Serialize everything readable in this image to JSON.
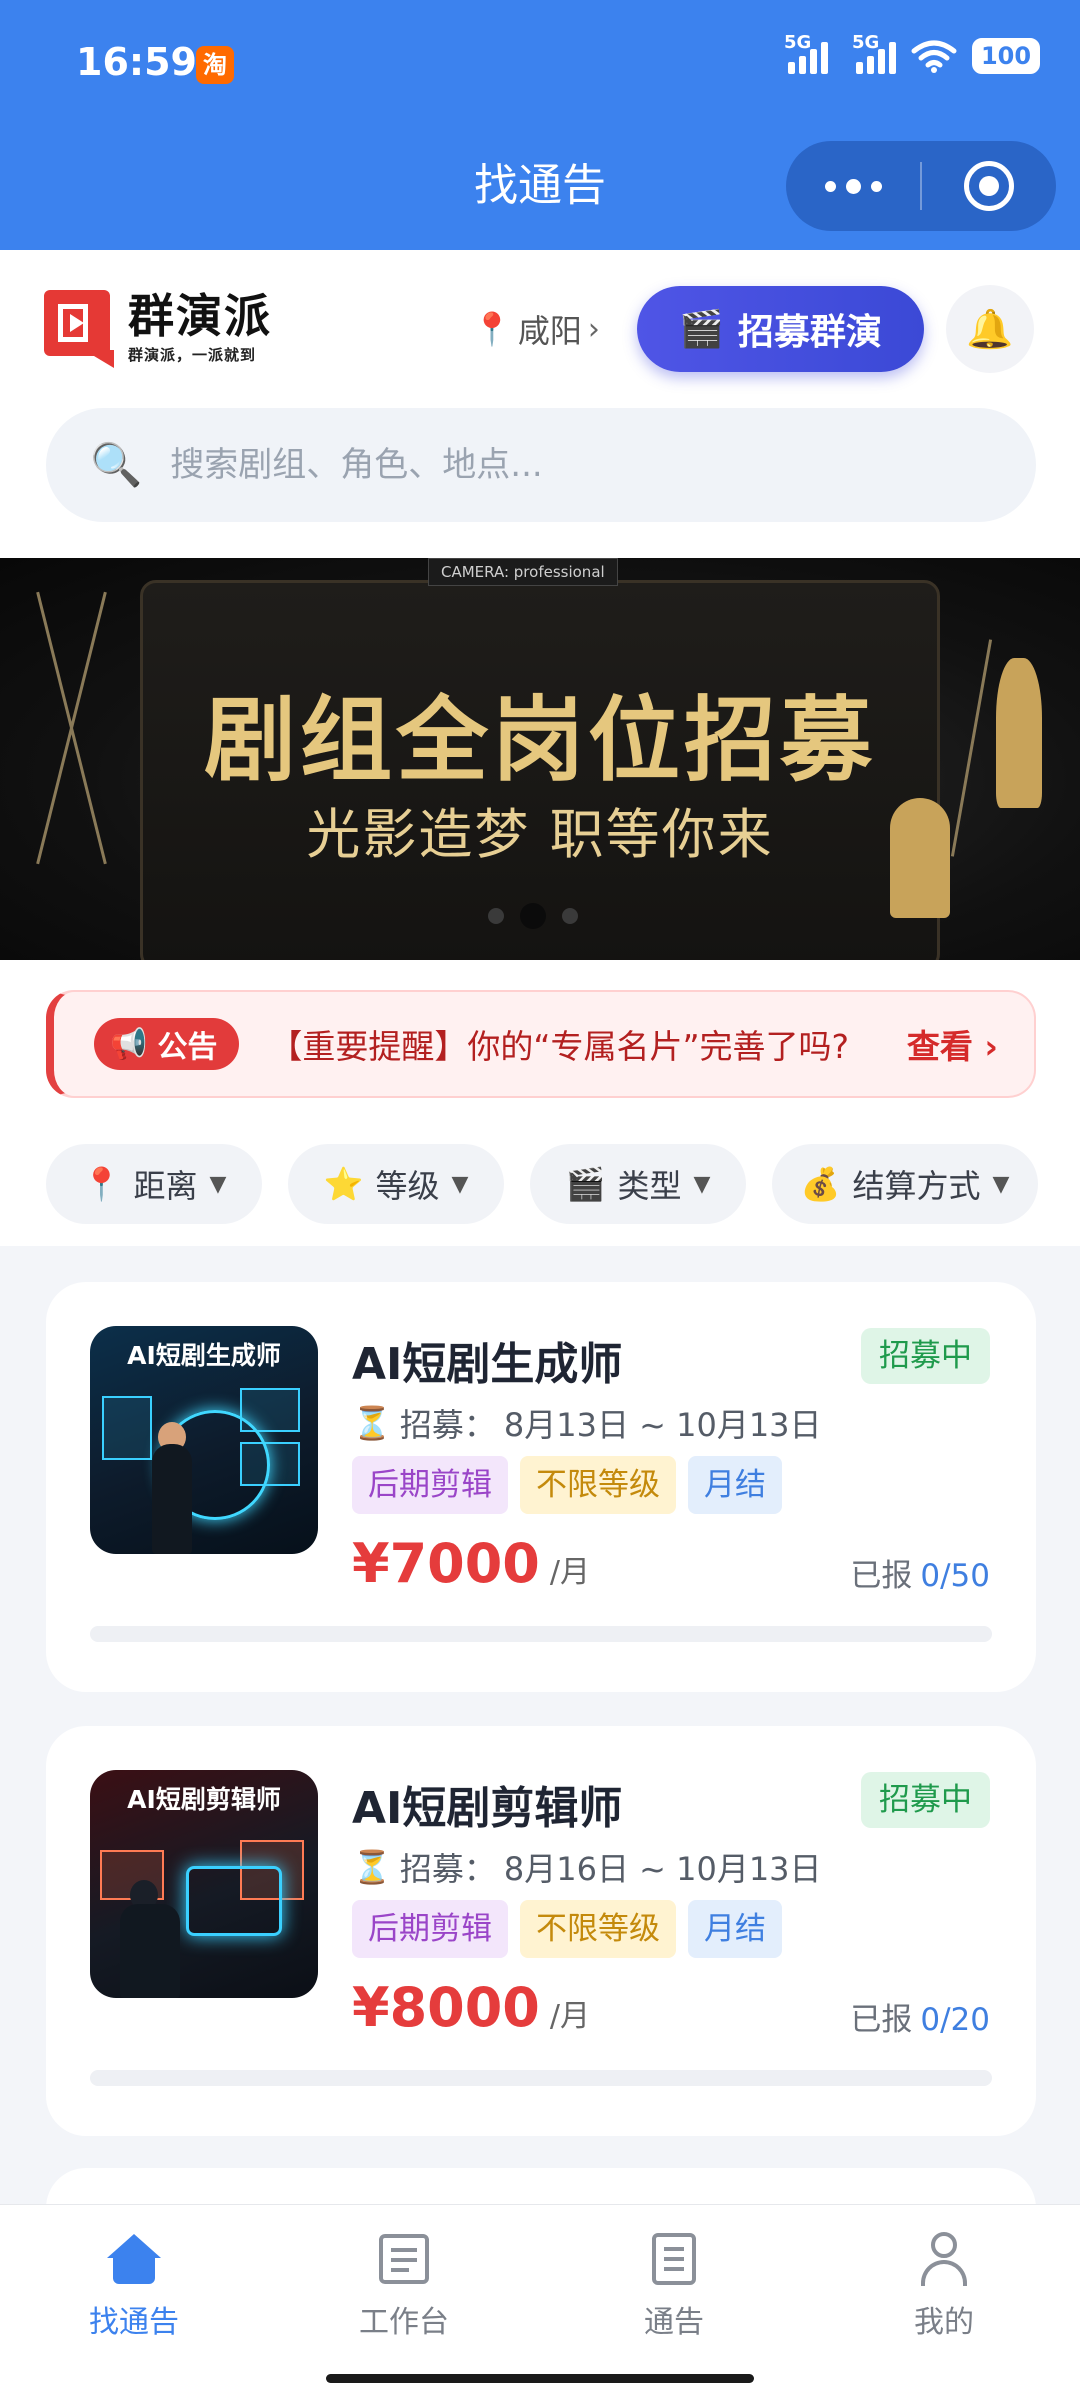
{
  "status_bar": {
    "time": "16:59",
    "app_badge": "淘",
    "network_1": "5G",
    "network_2": "5G",
    "battery": "100"
  },
  "nav": {
    "title": "找通告"
  },
  "header": {
    "brand_name": "群演派",
    "brand_slogan": "群演派，一派就到",
    "location": "咸阳",
    "recruit_button": "招募群演",
    "search_placeholder": "搜索剧组、角色、地点..."
  },
  "banner": {
    "camera_label": "CAMERA: professional",
    "title": "剧组全岗位招募",
    "subtitle": "光影造梦 职等你来",
    "slide_count": 3,
    "active_slide": 2
  },
  "notice": {
    "tag": "公告",
    "text": "【重要提醒】你的“专属名片”完善了吗?",
    "link": "查看 ›"
  },
  "filters": [
    {
      "icon": "📍",
      "label": "距离"
    },
    {
      "icon": "⭐",
      "label": "等级"
    },
    {
      "icon": "🎬",
      "label": "类型"
    },
    {
      "icon": "💰",
      "label": "结算方式"
    }
  ],
  "jobs": [
    {
      "thumb_caption": "AI短剧生成师",
      "title": "AI短剧生成师",
      "status": "招募中",
      "period_label": "招募：",
      "period": "8月13日 ~ 10月13日",
      "tags": [
        "后期剪辑",
        "不限等级",
        "月结"
      ],
      "price": "¥7000",
      "unit": "/月",
      "applied_label": "已报",
      "applied_count": "0/50",
      "progress": 0
    },
    {
      "thumb_caption": "AI短剧剪辑师",
      "title": "AI短剧剪辑师",
      "status": "招募中",
      "period_label": "招募：",
      "period": "8月16日 ~ 10月13日",
      "tags": [
        "后期剪辑",
        "不限等级",
        "月结"
      ],
      "price": "¥8000",
      "unit": "/月",
      "applied_label": "已报",
      "applied_count": "0/20",
      "progress": 0
    }
  ],
  "tabbar": [
    {
      "label": "找通告",
      "active": true
    },
    {
      "label": "工作台",
      "active": false
    },
    {
      "label": "通告",
      "active": false
    },
    {
      "label": "我的",
      "active": false
    }
  ],
  "colors": {
    "primary": "#3c82ee",
    "price": "#e53c3c",
    "status_green": "#1f9a4c",
    "notice_red": "#e23b3b"
  }
}
